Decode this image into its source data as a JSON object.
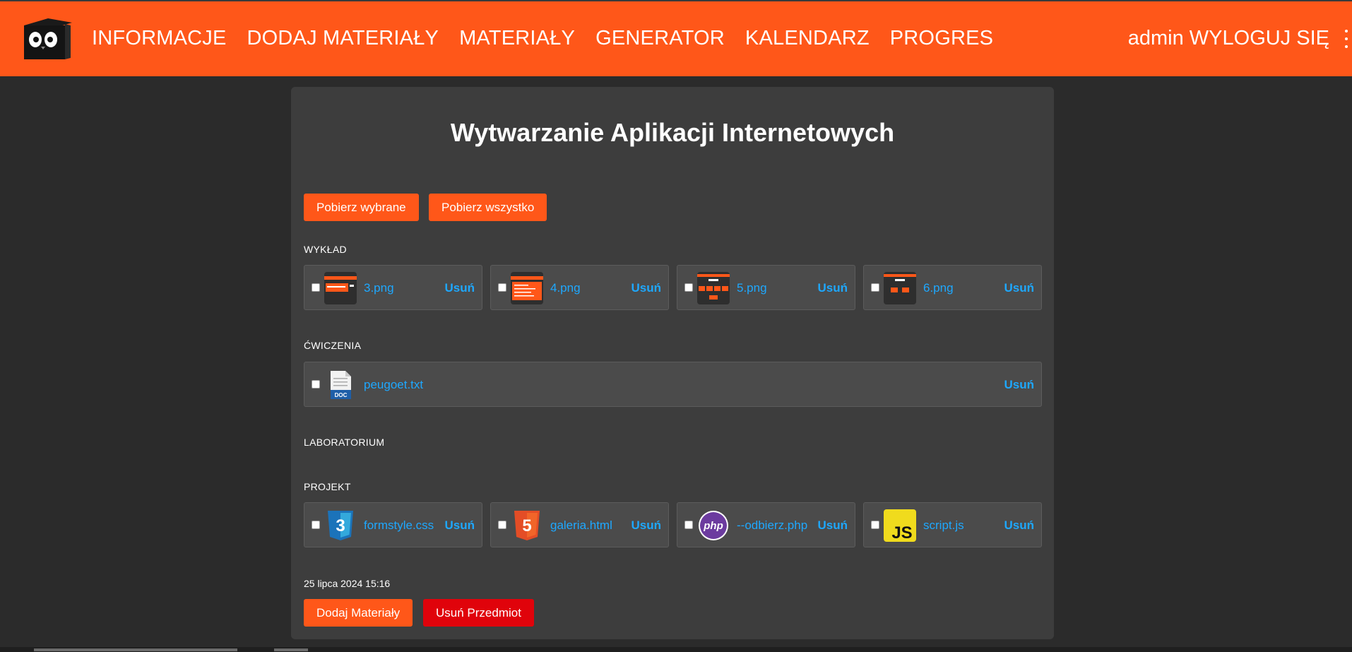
{
  "nav": {
    "items": [
      {
        "label": "INFORMACJE"
      },
      {
        "label": "DODAJ MATERIAŁY"
      },
      {
        "label": "MATERIAŁY"
      },
      {
        "label": "GENERATOR"
      },
      {
        "label": "KALENDARZ"
      },
      {
        "label": "PROGRES"
      }
    ],
    "user": "admin",
    "logout": "WYLOGUJ SIĘ"
  },
  "colors": {
    "brand": "#ff5719",
    "danger": "#e0030b",
    "link": "#1ea8ff",
    "background": "#2b2b2b",
    "card": "#3d3d3d"
  },
  "course": {
    "title": "Wytwarzanie Aplikacji Internetowych",
    "download_selected": "Pobierz wybrane",
    "download_all": "Pobierz wszystko",
    "sections": {
      "lecture": {
        "label": "WYKŁAD",
        "files": [
          {
            "name": "3.png",
            "icon": "image-thumbnail-icon",
            "delete": "Usuń"
          },
          {
            "name": "4.png",
            "icon": "image-thumbnail-icon",
            "delete": "Usuń"
          },
          {
            "name": "5.png",
            "icon": "image-thumbnail-icon",
            "delete": "Usuń"
          },
          {
            "name": "6.png",
            "icon": "image-thumbnail-icon",
            "delete": "Usuń"
          }
        ]
      },
      "exercises": {
        "label": "ĆWICZENIA",
        "files": [
          {
            "name": "peugoet.txt",
            "icon": "doc-file-icon",
            "icon_text": "DOC",
            "delete": "Usuń"
          }
        ]
      },
      "laboratory": {
        "label": "LABORATORIUM",
        "files": []
      },
      "project": {
        "label": "PROJEKT",
        "files": [
          {
            "name": "formstyle.css",
            "icon": "css3-icon",
            "icon_text": "3",
            "delete": "Usuń"
          },
          {
            "name": "galeria.html",
            "icon": "html5-icon",
            "icon_text": "5",
            "delete": "Usuń"
          },
          {
            "name": "--odbierz.php",
            "icon": "php-icon",
            "icon_text": "php",
            "delete": "Usuń"
          },
          {
            "name": "script.js",
            "icon": "js-icon",
            "icon_text": "JS",
            "delete": "Usuń"
          }
        ]
      }
    },
    "date": "25 lipca 2024 15:16",
    "add_materials": "Dodaj Materiały",
    "delete_subject": "Usuń Przedmiot"
  }
}
